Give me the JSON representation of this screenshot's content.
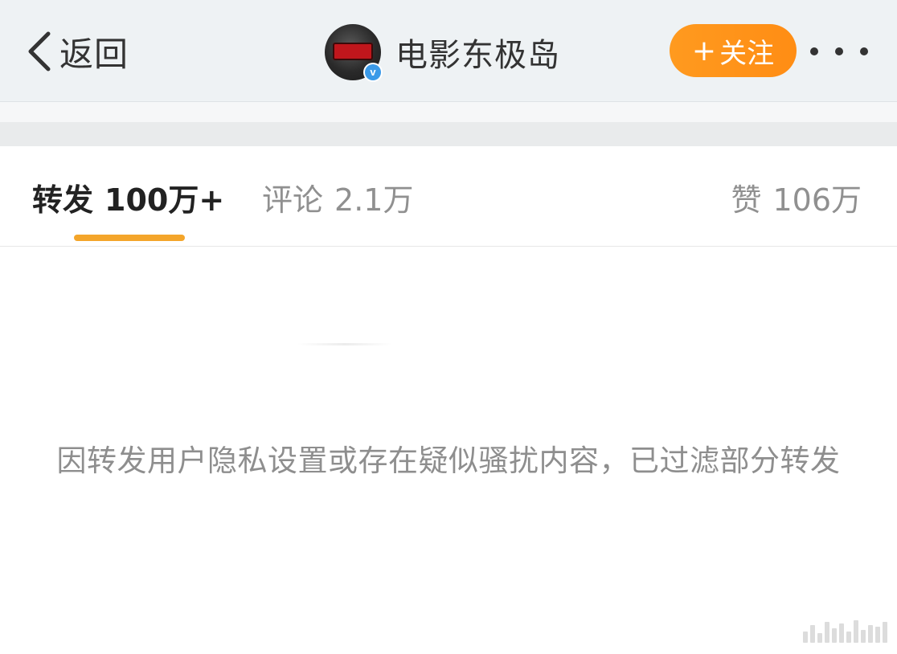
{
  "navbar": {
    "back_label": "返回",
    "account_name": "电影东极岛",
    "verified_mark": "v",
    "follow_label": "关注",
    "follow_plus": "+",
    "icons": {
      "back": "chevron-left-icon",
      "more": "more-dots-icon",
      "verified": "verified-badge-icon"
    },
    "colors": {
      "follow_button": "#ff9a1f",
      "verified_badge": "#3b9ae8"
    }
  },
  "tabs": [
    {
      "label": "转发",
      "count": "100万+",
      "active": true
    },
    {
      "label": "评论",
      "count": "2.1万",
      "active": false
    },
    {
      "label": "赞",
      "count": "106万",
      "active": false
    }
  ],
  "tab_indicator_color": "#f4a52a",
  "content": {
    "notice": "因转发用户隐私设置或存在疑似骚扰内容，已过滤部分转发"
  }
}
